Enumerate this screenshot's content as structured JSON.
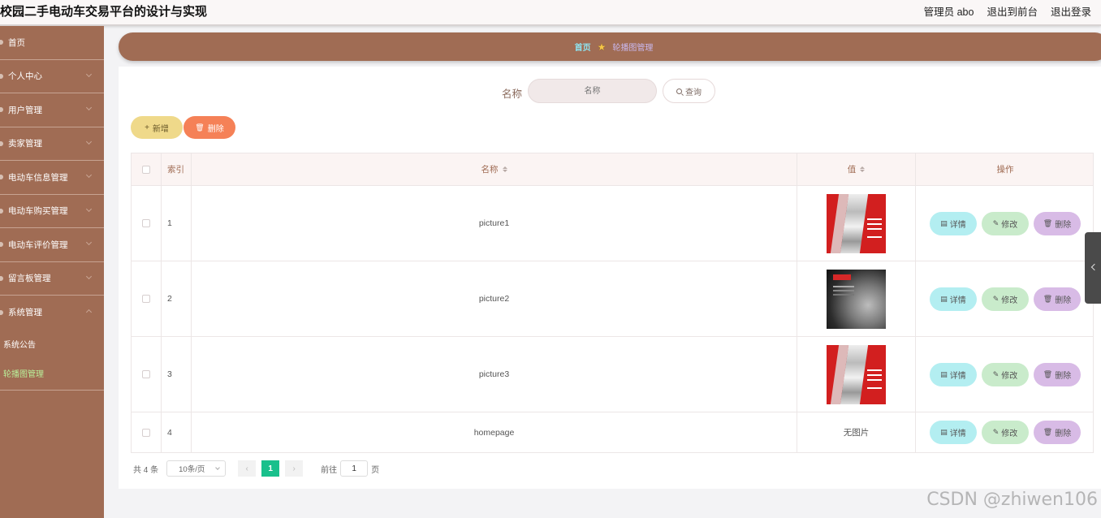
{
  "header": {
    "title": "校园二手电动车交易平台的设计与实现",
    "admin_label": "管理员 abo",
    "to_front_label": "退出到前台",
    "logout_label": "退出登录"
  },
  "sidebar": {
    "items": [
      {
        "label": "首页"
      },
      {
        "label": "个人中心"
      },
      {
        "label": "用户管理"
      },
      {
        "label": "卖家管理"
      },
      {
        "label": "电动车信息管理"
      },
      {
        "label": "电动车购买管理"
      },
      {
        "label": "电动车评价管理"
      },
      {
        "label": "留言板管理"
      },
      {
        "label": "系统管理"
      }
    ],
    "sub_items": [
      {
        "label": "系统公告"
      },
      {
        "label": "轮播图管理"
      }
    ]
  },
  "breadcrumb": {
    "home": "首页",
    "current": "轮播图管理"
  },
  "search": {
    "label": "名称",
    "placeholder": "名称",
    "button_label": "查询"
  },
  "actions": {
    "add_label": "新增",
    "delete_label": "删除"
  },
  "table": {
    "headers": {
      "index": "索引",
      "name": "名称",
      "value": "值",
      "ops": "操作"
    },
    "rows": [
      {
        "index": "1",
        "name": "picture1",
        "value_type": "image-red"
      },
      {
        "index": "2",
        "name": "picture2",
        "value_type": "image-dark"
      },
      {
        "index": "3",
        "name": "picture3",
        "value_type": "image-red"
      },
      {
        "index": "4",
        "name": "homepage",
        "value_text": "无图片"
      }
    ],
    "op_labels": {
      "detail": "详情",
      "edit": "修改",
      "delete": "删除"
    }
  },
  "pagination": {
    "total": "共 4 条",
    "page_size": "10条/页",
    "current_page": "1",
    "goto_prefix": "前往",
    "goto_value": "1",
    "goto_suffix": "页"
  },
  "watermark": "CSDN @zhiwen106",
  "colors": {
    "sidebar": "#a06c54",
    "accent_green": "#19c08c",
    "add_button": "#efd98a",
    "delete_button": "#f58157"
  }
}
